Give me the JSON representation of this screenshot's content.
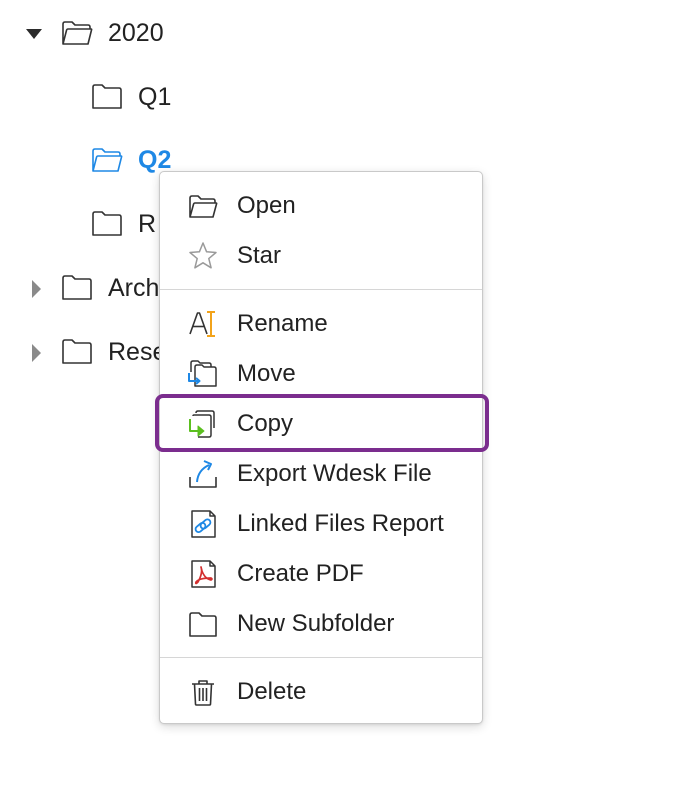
{
  "tree": {
    "items": [
      {
        "label": "2020",
        "caret": "caret-down-icon",
        "icon": "folder-open-icon",
        "selected": false
      },
      {
        "label": "Q1",
        "caret": null,
        "icon": "folder-icon",
        "selected": false
      },
      {
        "label": "Q2",
        "caret": null,
        "icon": "folder-open-icon",
        "selected": true
      },
      {
        "label": "R",
        "caret": null,
        "icon": "folder-icon",
        "selected": false
      },
      {
        "label": "Arch",
        "caret": "caret-right-icon",
        "icon": "folder-icon",
        "selected": false
      },
      {
        "label": "Rese",
        "caret": "caret-right-icon",
        "icon": "folder-icon",
        "selected": false
      }
    ]
  },
  "context_menu": {
    "items": [
      {
        "label": "Open",
        "icon": "folder-open-icon"
      },
      {
        "label": "Star",
        "icon": "star-icon"
      },
      {
        "label": "Rename",
        "icon": "rename-icon"
      },
      {
        "label": "Move",
        "icon": "move-folder-icon"
      },
      {
        "label": "Copy",
        "icon": "copy-icon",
        "highlighted": true
      },
      {
        "label": "Export Wdesk File",
        "icon": "export-icon"
      },
      {
        "label": "Linked Files Report",
        "icon": "linked-files-icon"
      },
      {
        "label": "Create PDF",
        "icon": "pdf-icon"
      },
      {
        "label": "New Subfolder",
        "icon": "folder-icon"
      },
      {
        "label": "Delete",
        "icon": "trash-icon"
      }
    ]
  },
  "colors": {
    "selected_text": "#1e88e5",
    "highlight_border": "#7b2d8e",
    "copy_accent": "#5bbf1f",
    "move_accent": "#1e88e5",
    "rename_accent": "#f2a31b",
    "pdf_accent": "#d32f2f"
  }
}
